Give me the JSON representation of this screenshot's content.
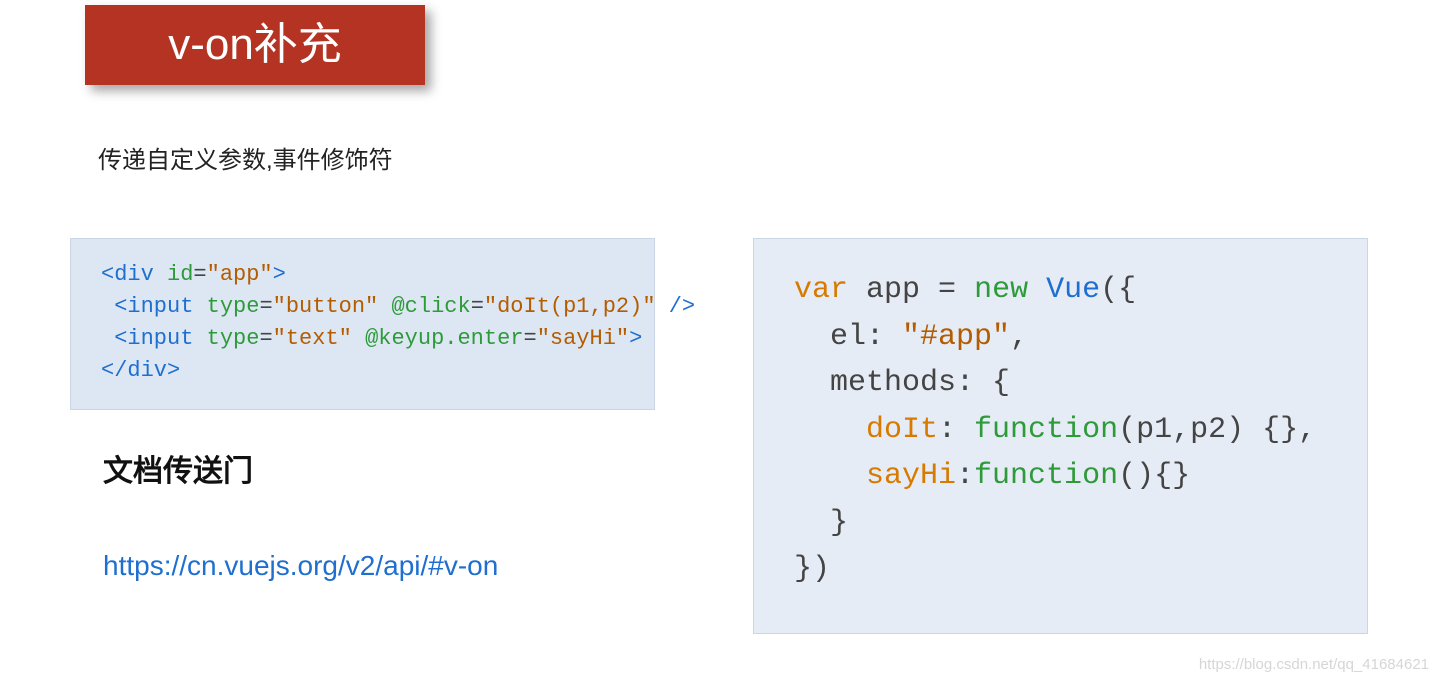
{
  "title": "v-on补充",
  "subtitle": "传递自定义参数,事件修饰符",
  "doc_heading": "文档传送门",
  "doc_link": "https://cn.vuejs.org/v2/api/#v-on",
  "watermark": "https://blog.csdn.net/qq_41684621",
  "left_code": {
    "l1": {
      "open": "<div",
      "sp": " ",
      "attr": "id",
      "eq": "=",
      "val": "\"app\"",
      "close": ">"
    },
    "l2": {
      "indent": " ",
      "open": "<input",
      "sp": " ",
      "attr1": "type",
      "eq1": "=",
      "val1": "\"button\"",
      "sp2": " ",
      "attr2": "@click",
      "eq2": "=",
      "val2": "\"doIt(p1,p2)\"",
      "close": " />"
    },
    "l3": {
      "indent": " ",
      "open": "<input",
      "sp": " ",
      "attr1": "type",
      "eq1": "=",
      "val1": "\"text\"",
      "sp2": " ",
      "attr2": "@keyup.enter",
      "eq2": "=",
      "val2": "\"sayHi\"",
      "close": ">"
    },
    "l4": {
      "close": "</div>"
    }
  },
  "right_code": {
    "l1": {
      "kw": "var",
      "sp1": " ",
      "name": "app ",
      "eq": "= ",
      "new": "new",
      "sp2": " ",
      "cls": "Vue",
      "tail": "({"
    },
    "l2": {
      "indent": "  ",
      "text": "el: ",
      "val": "\"#app\"",
      "tail": ","
    },
    "l3": {
      "indent": "  ",
      "text": "methods: {"
    },
    "l4": {
      "indent": "    ",
      "name": "doIt",
      "colon": ": ",
      "fn": "function",
      "args": "(p1,p2) {},"
    },
    "l5": {
      "indent": "    ",
      "name": "sayHi",
      "colon": ":",
      "fn": "function",
      "args": "(){}"
    },
    "l6": {
      "indent": "  ",
      "text": "}"
    },
    "l7": {
      "text": "})"
    }
  }
}
